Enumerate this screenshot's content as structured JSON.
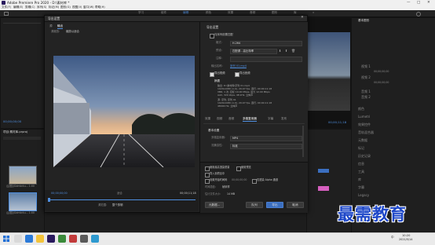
{
  "window": {
    "title": "Adobe Premiere Pro 2020 - D:\\素材库 *",
    "controls": [
      "—",
      "□",
      "✕"
    ]
  },
  "menu": [
    "文件(F)",
    "编辑(E)",
    "剪辑(C)",
    "序列(S)",
    "标记(M)",
    "图形(G)",
    "视图(V)",
    "窗口(W)",
    "帮助(H)"
  ],
  "workspace_tabs": [
    "学习",
    "组件",
    "编辑",
    "颜色",
    "效果",
    "音频",
    "图形",
    "库",
    "»"
  ],
  "left_panel": {
    "timecode": "00;00;00;00",
    "project_label": "项目:素材库.prproj",
    "clip1": "山(图)/Gdmkntu... 1:00",
    "clip2": "山(图)/Gdmkntu... 1:00"
  },
  "dialog": {
    "title": "导出设置",
    "source_tabs": [
      "源",
      "输出"
    ],
    "source_scaling_label": "源缩放:",
    "source_scaling_value": "缩放以适合",
    "export_settings_title": "导出设置",
    "match_sequence_label": "与序列设置匹配",
    "format_label": "格式:",
    "format_value": "H.264",
    "preset_label": "预设:",
    "preset_value": "匹配源 - 高比特率",
    "comments_label": "注释:",
    "output_name_label": "输出名称:",
    "output_name_value": "序列 01.mp4",
    "export_video": "导出视频",
    "export_audio": "导出音频",
    "summary_title": "摘要",
    "summary_lines": [
      "输出: D:\\素材库\\序列 01.mp4",
      "1920x1080 (1.0), 29.97 fps, 逐行, 00:00:11:18",
      "VBR, 1 次, 目标 10.00 Mbps, 最大 12.00 Mbps",
      "AAC, 320 kbps, 48 kHz, 立体声",
      "源: 序列, 序列 01",
      "1920x1080 (1.0), 29.97 fps, 逐行, 00:00:11:18",
      "48000 Hz, 立体声"
    ],
    "output_tabs": [
      "效果",
      "视频",
      "音频",
      "多路复用器",
      "字幕",
      "发布"
    ],
    "basic_settings_title": "基本设置",
    "multiplexer_label": "多路复用器:",
    "multiplexer_value": "MP4",
    "stream_compat_label": "流兼容性:",
    "stream_compat_value": "标准",
    "use_max_render": "使用最高渲染质量",
    "use_previews": "使用预览",
    "import_into_project": "导入到项目中",
    "set_start_timecode": "设置开始时间码",
    "start_timecode_value": "00;00;00;00",
    "render_alpha": "仅渲染 Alpha 通道",
    "time_interpolation_label": "时间插值:",
    "time_interpolation_value": "帧采样",
    "estimated_size_label": "估计文件大小:",
    "estimated_size_value": "14 MB",
    "buttons": [
      "元数据...",
      "队列",
      "导出",
      "取消"
    ],
    "timeline_tc_left": "00;00;00;00",
    "timeline_tc_right": "00;00;11;18",
    "fit_label": "适合",
    "source_range_label": "源范围:",
    "source_range_value": "整个剪辑"
  },
  "program_monitor": {
    "timecode": "00;00;11;18"
  },
  "right_panel": {
    "title": "基本图形",
    "items": [
      "视频 1",
      "00;00;00;00",
      "视频 2",
      "00;00;00;00",
      "音频 1",
      "音频 2",
      "颜色",
      "Lumetri",
      "效果控件",
      "音轨混合器",
      "元数据",
      "标记",
      "历史记录",
      "信息",
      "工具",
      "库",
      "字幕",
      "Legacy"
    ]
  },
  "watermark": "最需教育",
  "taskbar": {
    "time": "10:20",
    "date": "2021/5/14",
    "lang": "中"
  },
  "colors": {
    "accent": "#4f8fe0",
    "dialog_bg": "#232323",
    "watermark": "#1e47c8"
  }
}
